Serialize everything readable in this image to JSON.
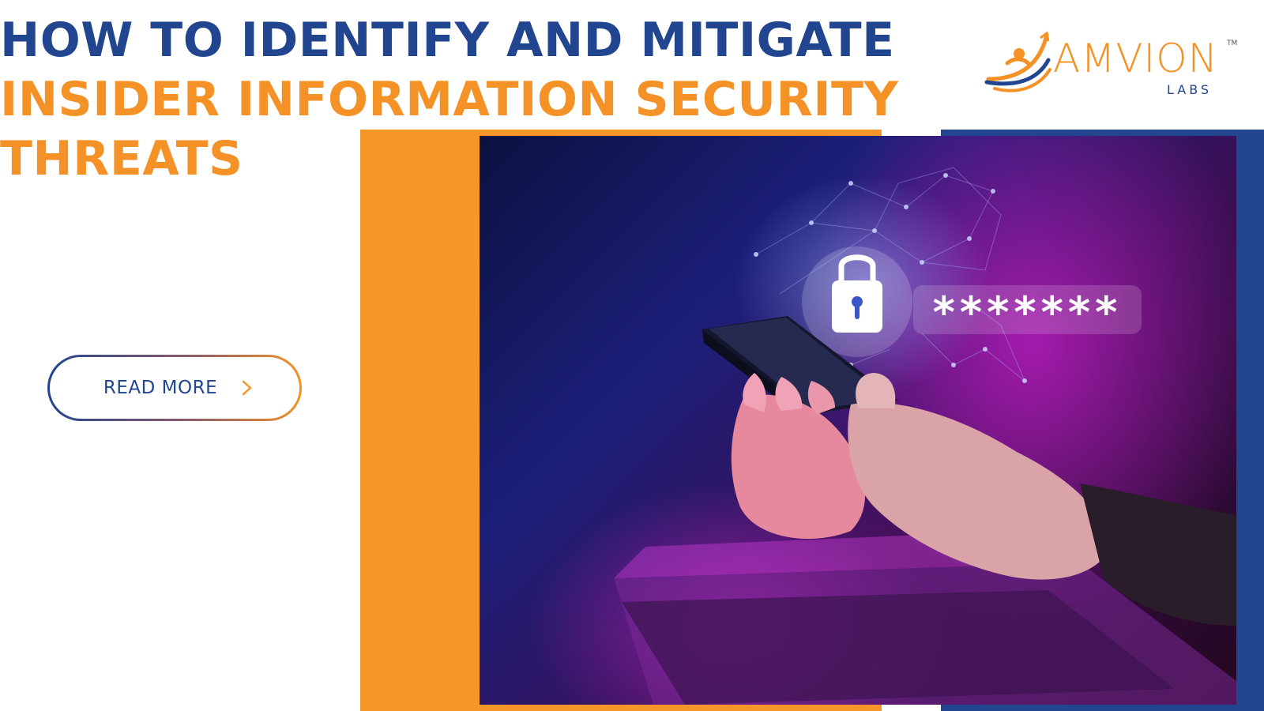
{
  "title": {
    "line1": "HOW TO IDENTIFY AND MITIGATE",
    "line2": "INSIDER INFORMATION SECURITY",
    "line3": "THREATS"
  },
  "logo": {
    "name": "AMVION",
    "sub": "LABS",
    "tm": "TM"
  },
  "cta": {
    "label": "READ MORE",
    "icon": "chevron-right-icon"
  },
  "photo": {
    "password_mask": "*******",
    "icons": [
      "padlock-icon",
      "smartphone"
    ]
  },
  "colors": {
    "brand_blue": "#21458f",
    "brand_orange": "#f49227"
  }
}
